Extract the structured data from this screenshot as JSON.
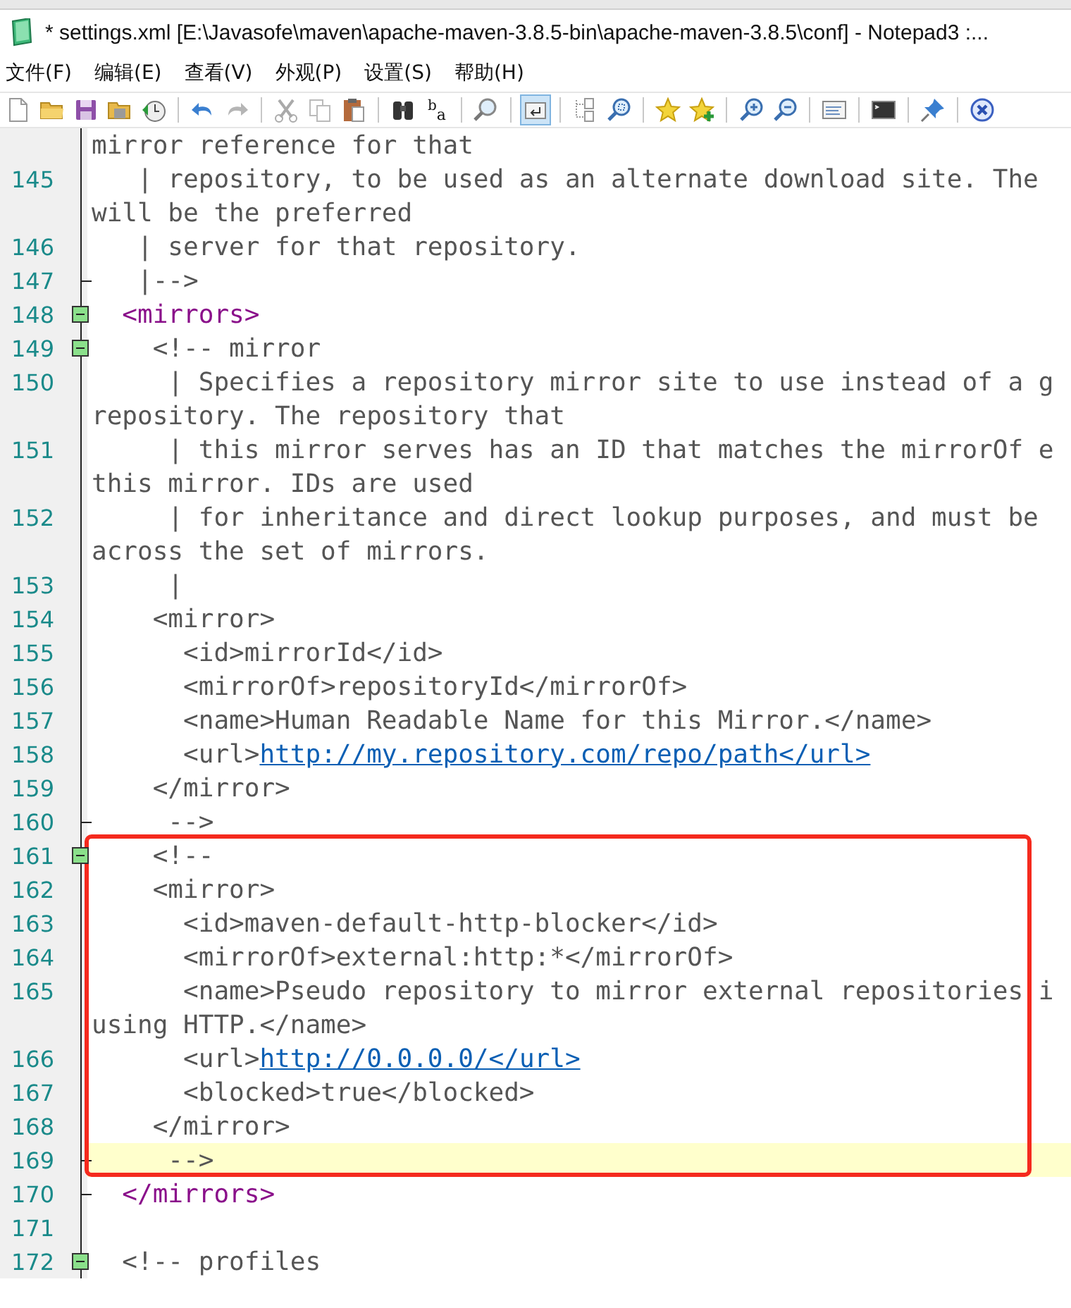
{
  "window": {
    "title": "* settings.xml [E:\\Javasofe\\maven\\apache-maven-3.8.5-bin\\apache-maven-3.8.5\\conf] - Notepad3 :..."
  },
  "menu": [
    "文件(F)",
    "编辑(E)",
    "查看(V)",
    "外观(P)",
    "设置(S)",
    "帮助(H)"
  ],
  "toolbar_groups": [
    [
      {
        "kind": "new",
        "pressed": false
      },
      {
        "kind": "open",
        "pressed": false
      },
      {
        "kind": "save",
        "pressed": false
      },
      {
        "kind": "saveas",
        "pressed": false
      },
      {
        "kind": "revert",
        "pressed": false
      }
    ],
    [
      {
        "kind": "undo",
        "pressed": false
      },
      {
        "kind": "redo",
        "pressed": false
      }
    ],
    [
      {
        "kind": "cut",
        "pressed": false
      },
      {
        "kind": "copy",
        "pressed": false
      },
      {
        "kind": "paste",
        "pressed": false
      }
    ],
    [
      {
        "kind": "find",
        "pressed": false
      },
      {
        "kind": "replace",
        "pressed": false,
        "glyphs": [
          "b",
          "a"
        ]
      }
    ],
    [
      {
        "kind": "search",
        "pressed": false
      }
    ],
    [
      {
        "kind": "wrap",
        "pressed": true
      }
    ],
    [
      {
        "kind": "tree",
        "pressed": false
      },
      {
        "kind": "zoomfit",
        "pressed": false
      }
    ],
    [
      {
        "kind": "star",
        "pressed": false
      },
      {
        "kind": "starplus",
        "pressed": false
      }
    ],
    [
      {
        "kind": "zoomin",
        "pressed": false
      },
      {
        "kind": "zoomout",
        "pressed": false
      }
    ],
    [
      {
        "kind": "window",
        "pressed": false
      }
    ],
    [
      {
        "kind": "terminal",
        "pressed": false
      }
    ],
    [
      {
        "kind": "pin",
        "pressed": false
      }
    ],
    [
      {
        "kind": "close",
        "pressed": false
      }
    ]
  ],
  "editor": {
    "blocks": [
      {
        "highlighted": false,
        "rows": [
          {
            "kind": "line",
            "current": false,
            "spans": [
              {
                "kind": "comment",
                "text": "mirror reference for that"
              }
            ]
          },
          {
            "kind": "line",
            "number": "145",
            "current": false,
            "spans": [
              {
                "kind": "comment",
                "text": "   | repository, to be used as an alternate download site. The"
              }
            ]
          },
          {
            "kind": "line",
            "current": false,
            "spans": [
              {
                "kind": "comment",
                "text": "will be the preferred"
              }
            ]
          },
          {
            "kind": "line",
            "number": "146",
            "current": false,
            "spans": [
              {
                "kind": "comment",
                "text": "   | server for that repository."
              }
            ]
          },
          {
            "kind": "fold_end",
            "number": "147",
            "current": false,
            "spans": [
              {
                "kind": "comment",
                "text": "   |-->"
              }
            ]
          },
          {
            "kind": "fold_start",
            "number": "148",
            "current": false,
            "spans": [
              {
                "kind": "tag",
                "text": "  <mirrors>"
              }
            ]
          },
          {
            "kind": "fold_start",
            "number": "149",
            "current": false,
            "spans": [
              {
                "kind": "comment",
                "text": "    <!-- mirror"
              }
            ]
          },
          {
            "kind": "line",
            "number": "150",
            "current": false,
            "spans": [
              {
                "kind": "comment",
                "text": "     | Specifies a repository mirror site to use instead of a g"
              }
            ]
          },
          {
            "kind": "line",
            "current": false,
            "spans": [
              {
                "kind": "comment",
                "text": "repository. The repository that"
              }
            ]
          },
          {
            "kind": "line",
            "number": "151",
            "current": false,
            "spans": [
              {
                "kind": "comment",
                "text": "     | this mirror serves has an ID that matches the mirrorOf e"
              }
            ]
          },
          {
            "kind": "line",
            "current": false,
            "spans": [
              {
                "kind": "comment",
                "text": "this mirror. IDs are used"
              }
            ]
          },
          {
            "kind": "line",
            "number": "152",
            "current": false,
            "spans": [
              {
                "kind": "comment",
                "text": "     | for inheritance and direct lookup purposes, and must be"
              }
            ]
          },
          {
            "kind": "line",
            "current": false,
            "spans": [
              {
                "kind": "comment",
                "text": "across the set of mirrors."
              }
            ]
          },
          {
            "kind": "line",
            "number": "153",
            "current": false,
            "spans": [
              {
                "kind": "comment",
                "text": "     |"
              }
            ]
          },
          {
            "kind": "line",
            "number": "154",
            "current": false,
            "spans": [
              {
                "kind": "comment",
                "text": "    <mirror>"
              }
            ]
          },
          {
            "kind": "line",
            "number": "155",
            "current": false,
            "spans": [
              {
                "kind": "comment",
                "text": "      <id>mirrorId</id>"
              }
            ]
          },
          {
            "kind": "line",
            "number": "156",
            "current": false,
            "spans": [
              {
                "kind": "comment",
                "text": "      <mirrorOf>repositoryId</mirrorOf>"
              }
            ]
          },
          {
            "kind": "line",
            "number": "157",
            "current": false,
            "spans": [
              {
                "kind": "comment",
                "text": "      <name>Human Readable Name for this Mirror.</name>"
              }
            ]
          },
          {
            "kind": "line",
            "number": "158",
            "current": false,
            "spans": [
              {
                "kind": "comment",
                "text": "      <url>"
              },
              {
                "kind": "link",
                "text": "http://my.repository.com/repo/path</url>"
              }
            ]
          },
          {
            "kind": "line",
            "number": "159",
            "current": false,
            "spans": [
              {
                "kind": "comment",
                "text": "    </mirror>"
              }
            ]
          },
          {
            "kind": "fold_end",
            "number": "160",
            "current": false,
            "spans": [
              {
                "kind": "comment",
                "text": "     -->"
              }
            ]
          }
        ]
      },
      {
        "highlighted": true,
        "rows": [
          {
            "kind": "fold_start",
            "number": "161",
            "current": false,
            "spans": [
              {
                "kind": "comment",
                "text": "    <!--"
              }
            ]
          },
          {
            "kind": "line",
            "number": "162",
            "current": false,
            "spans": [
              {
                "kind": "comment",
                "text": "    <mirror>"
              }
            ]
          },
          {
            "kind": "line",
            "number": "163",
            "current": false,
            "spans": [
              {
                "kind": "comment",
                "text": "      <id>maven-default-http-blocker</id>"
              }
            ]
          },
          {
            "kind": "line",
            "number": "164",
            "current": false,
            "spans": [
              {
                "kind": "comment",
                "text": "      <mirrorOf>external:http:*</mirrorOf>"
              }
            ]
          },
          {
            "kind": "line",
            "number": "165",
            "current": false,
            "spans": [
              {
                "kind": "comment",
                "text": "      <name>Pseudo repository to mirror external repositories i"
              }
            ]
          },
          {
            "kind": "line",
            "current": false,
            "spans": [
              {
                "kind": "comment",
                "text": "using HTTP.</name>"
              }
            ]
          },
          {
            "kind": "line",
            "number": "166",
            "current": false,
            "spans": [
              {
                "kind": "comment",
                "text": "      <url>"
              },
              {
                "kind": "link",
                "text": "http://0.0.0.0/</url>"
              }
            ]
          },
          {
            "kind": "line",
            "number": "167",
            "current": false,
            "spans": [
              {
                "kind": "comment",
                "text": "      <blocked>true</blocked>"
              }
            ]
          },
          {
            "kind": "line",
            "number": "168",
            "current": false,
            "spans": [
              {
                "kind": "comment",
                "text": "    </mirror>"
              }
            ]
          },
          {
            "kind": "fold_end",
            "number": "169",
            "current": true,
            "spans": [
              {
                "kind": "comment",
                "text": "     -->"
              }
            ]
          }
        ]
      },
      {
        "highlighted": false,
        "rows": [
          {
            "kind": "fold_end",
            "number": "170",
            "current": false,
            "spans": [
              {
                "kind": "tag",
                "text": "  </mirrors>"
              }
            ]
          },
          {
            "kind": "line",
            "number": "171",
            "current": false,
            "spans": []
          },
          {
            "kind": "fold_start",
            "number": "172",
            "current": false,
            "spans": [
              {
                "kind": "comment",
                "text": "  <!-- profiles"
              }
            ]
          }
        ]
      }
    ]
  }
}
